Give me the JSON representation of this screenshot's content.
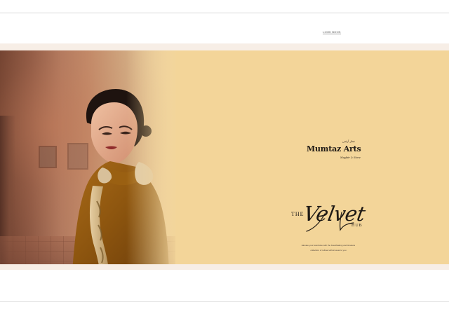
{
  "header": {
    "link_label": "LOOK BOOK"
  },
  "brand": {
    "script_text": "عطر آرٹس",
    "name": "Mumtaz Arts",
    "tagline": "Mayfair & Store",
    "title_prefix": "THE",
    "title_main": "Velvet",
    "title_suffix": "HUB",
    "description_line_1": "Elevate your wardrobe with the breathtaking and timeless",
    "description_line_2": "collection of refined ethnic wear to you"
  },
  "colors": {
    "banner_bg": "#f3d599",
    "frame_bg": "#f7eee6",
    "text_dark": "#1f1a15"
  }
}
